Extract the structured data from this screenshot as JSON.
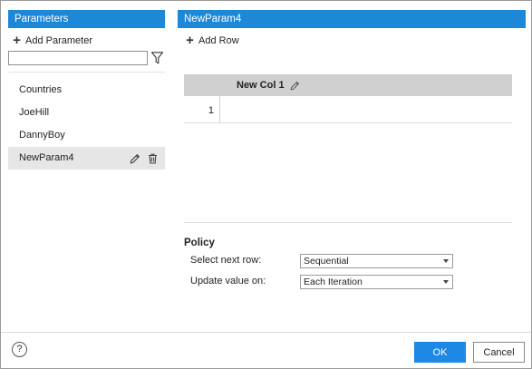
{
  "left_panel": {
    "header": "Parameters",
    "add_label": "Add Parameter",
    "search": {
      "value": "",
      "placeholder": ""
    },
    "items": [
      {
        "label": "Countries"
      },
      {
        "label": "JoeHill"
      },
      {
        "label": "DannyBoy"
      },
      {
        "label": "NewParam4"
      }
    ]
  },
  "right_panel": {
    "header": "NewParam4",
    "add_row_label": "Add Row",
    "grid": {
      "columns": [
        "New Col 1"
      ],
      "rows": [
        {
          "num": "1",
          "value": ""
        }
      ]
    },
    "policy": {
      "title": "Policy",
      "select_next_row_label": "Select next row:",
      "select_next_row_value": "Sequential",
      "update_value_label": "Update value on:",
      "update_value_value": "Each Iteration"
    }
  },
  "footer": {
    "help_glyph": "?",
    "ok_label": "OK",
    "cancel_label": "Cancel"
  },
  "colors": {
    "header_blue": "#1e88d8",
    "ok_blue": "#1e88e5",
    "grid_header_gray": "#d0d0d0",
    "selected_row_gray": "#e6e6e6"
  },
  "icons": [
    "plus-icon",
    "filter-icon",
    "pencil-icon",
    "trash-icon",
    "help-icon",
    "chevron-down-icon"
  ]
}
